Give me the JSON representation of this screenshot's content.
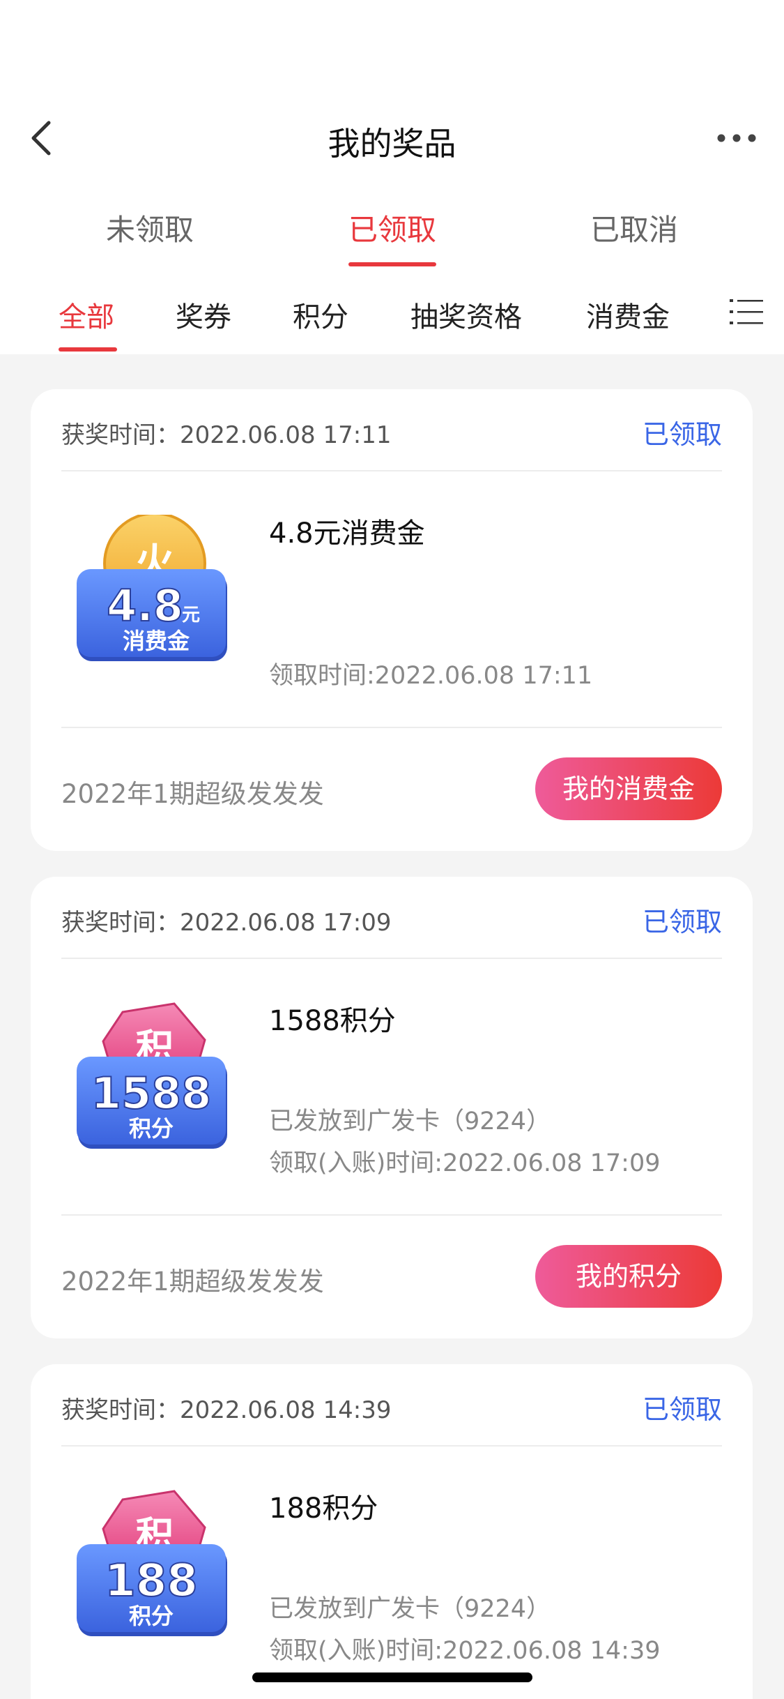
{
  "nav": {
    "title": "我的奖品",
    "back_icon": "chevron-left-icon",
    "more_icon": "more-dots-icon"
  },
  "tabs": [
    {
      "label": "未领取",
      "active": false
    },
    {
      "label": "已领取",
      "active": true
    },
    {
      "label": "已取消",
      "active": false
    }
  ],
  "subtabs": [
    {
      "label": "全部",
      "active": true
    },
    {
      "label": "奖券",
      "active": false
    },
    {
      "label": "积分",
      "active": false
    },
    {
      "label": "抽奖资格",
      "active": false
    },
    {
      "label": "消费金",
      "active": false
    }
  ],
  "list_icon": "list-menu-icon",
  "colors": {
    "accent_red": "#e8383d",
    "status_blue": "#3a66e6",
    "button_gradient_start": "#ee5b9a",
    "button_gradient_end": "#ec3a37",
    "badge_blue": "#4f7ff0",
    "coin_gold": "#f5b93a",
    "tag_pink": "#ec4a88"
  },
  "cards": [
    {
      "win_time": "获奖时间：2022.06.08 17:11",
      "status": "已领取",
      "image": {
        "kind": "coin",
        "top_glyph": "火",
        "amount": "4.8",
        "unit": "元",
        "caption": "消费金"
      },
      "name": "4.8元消费金",
      "line1": "",
      "line2": "领取时间:2022.06.08 17:11",
      "activity": "2022年1期超级发发发",
      "button": "我的消费金"
    },
    {
      "win_time": "获奖时间：2022.06.08 17:09",
      "status": "已领取",
      "image": {
        "kind": "points",
        "top_glyph": "积",
        "amount": "1588",
        "unit": "",
        "caption": "积分"
      },
      "name": "1588积分",
      "line1": "已发放到广发卡（9224）",
      "line2": "领取(入账)时间:2022.06.08 17:09",
      "activity": "2022年1期超级发发发",
      "button": "我的积分"
    },
    {
      "win_time": "获奖时间：2022.06.08 14:39",
      "status": "已领取",
      "image": {
        "kind": "points",
        "top_glyph": "积",
        "amount": "188",
        "unit": "",
        "caption": "积分"
      },
      "name": "188积分",
      "line1": "已发放到广发卡（9224）",
      "line2": "领取(入账)时间:2022.06.08 14:39",
      "activity": "",
      "button": ""
    }
  ]
}
